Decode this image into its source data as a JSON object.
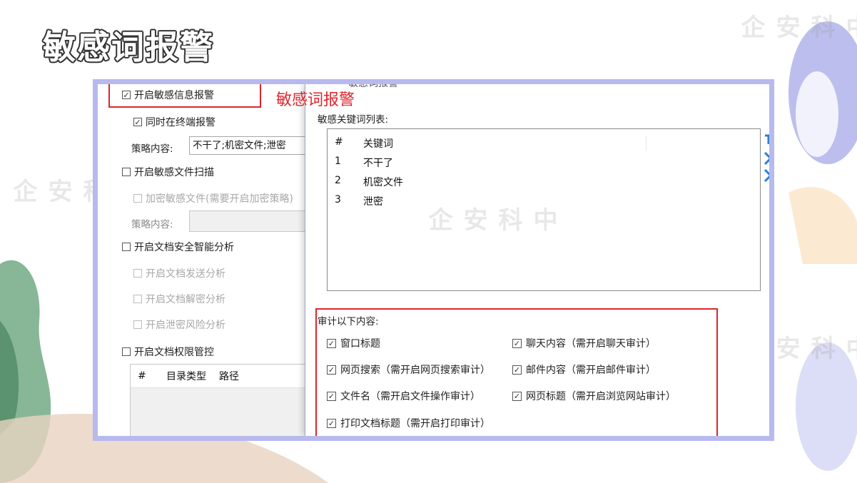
{
  "slide": {
    "title": "敏感词报警"
  },
  "watermark": {
    "text": "中科安企"
  },
  "left_panel": {
    "enable_alert": {
      "label": "开启敏感信息报警",
      "checked": true
    },
    "terminal_alert": {
      "label": "同时在终端报警",
      "checked": true
    },
    "policy_label_1": "策略内容:",
    "policy_value_1": "不干了;机密文件;泄密",
    "enable_scan": {
      "label": "开启敏感文件扫描",
      "checked": false
    },
    "encrypt_sensitive": {
      "label": "加密敏感文件(需要开启加密策略)",
      "checked": false
    },
    "policy_label_2": "策略内容:",
    "policy_value_2": "",
    "enable_doc_analysis": {
      "label": "开启文档安全智能分析",
      "checked": false
    },
    "doc_send_analysis": {
      "label": "开启文档发送分析",
      "checked": false
    },
    "doc_decrypt_analysis": {
      "label": "开启文档解密分析",
      "checked": false
    },
    "leak_risk_analysis": {
      "label": "开启泄密风险分析",
      "checked": false
    },
    "enable_permission": {
      "label": "开启文档权限管控",
      "checked": false
    },
    "table_headers": [
      "#",
      "目录类型",
      "路径"
    ]
  },
  "callout": "敏感词报警",
  "dialog": {
    "partial_title": "敏感词报警",
    "keyword_list_label": "敏感关键词列表:",
    "keyword_headers": [
      "#",
      "关键词"
    ],
    "keywords": [
      {
        "num": "1",
        "word": "不干了"
      },
      {
        "num": "2",
        "word": "机密文件"
      },
      {
        "num": "3",
        "word": "泄密"
      }
    ],
    "audit_label": "审计以下内容:",
    "audit_items": [
      {
        "label": "窗口标题",
        "checked": true
      },
      {
        "label": "聊天内容（需开启聊天审计）",
        "checked": true
      },
      {
        "label": "网页搜索（需开启网页搜索审计）",
        "checked": true
      },
      {
        "label": "邮件内容（需开启邮件审计）",
        "checked": true
      },
      {
        "label": "文件名（需开启文件操作审计）",
        "checked": true
      },
      {
        "label": "网页标题（需开启浏览网站审计）",
        "checked": true
      },
      {
        "label": "打印文档标题（需开启打印审计）",
        "checked": true
      }
    ],
    "check_mark": "✓"
  },
  "colors": {
    "frame": "#b7b9ef",
    "highlight": "#d9262c",
    "accent_blue": "#2d7fd0"
  }
}
